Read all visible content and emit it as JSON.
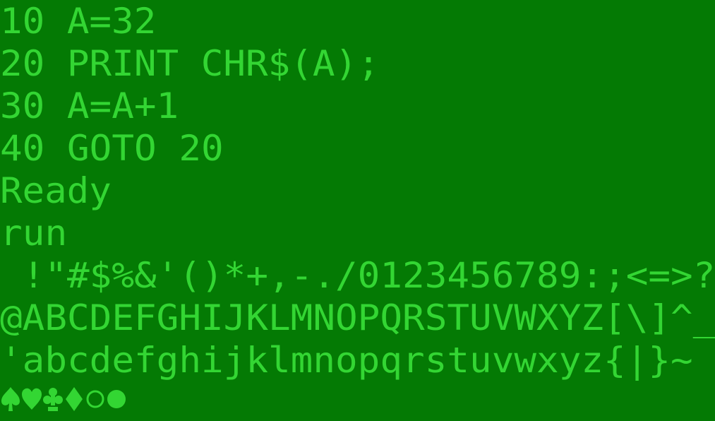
{
  "terminal": {
    "lines": [
      "10 A=32",
      "20 PRINT CHR$(A);",
      "30 A=A+1",
      "40 GOTO 20",
      "Ready",
      "run",
      " !\"#$%&'()*+,-./0123456789:;<=>?",
      "@ABCDEFGHIJKLMNOPQRSTUVWXYZ[\\]^_",
      "'abcdefghijklmnopqrstuvwxyz{|}~"
    ],
    "glyphs": [
      "spade-icon",
      "heart-icon",
      "club-icon",
      "diamond-icon",
      "circle-outline-icon",
      "circle-filled-icon"
    ]
  },
  "colors": {
    "background": "#047a04",
    "text": "#33d633"
  }
}
